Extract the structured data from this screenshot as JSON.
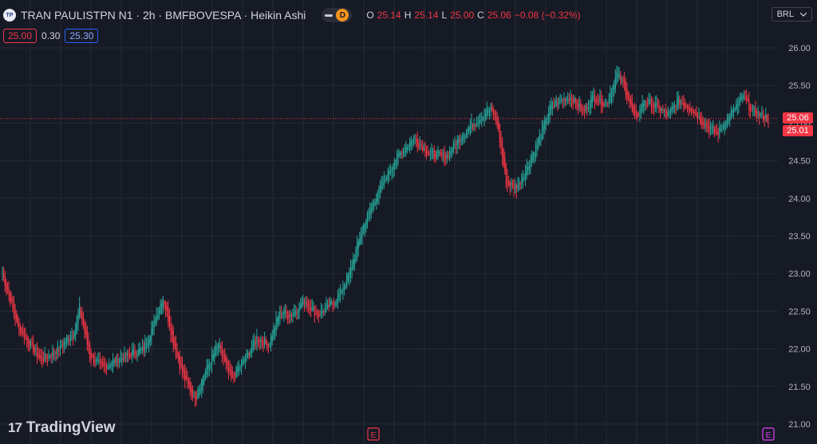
{
  "header": {
    "symbol_icon": "TP",
    "symbol_title": "TRAN PAULISTPN N1 · 2h · BMFBOVESPA · Heikin Ashi",
    "chip_d": "D",
    "ohlc": {
      "o_label": "O",
      "o": "25.14",
      "h_label": "H",
      "h": "25.14",
      "l_label": "L",
      "l": "25.00",
      "c_label": "C",
      "c": "25.06",
      "change": "−0.08 (−0.32%)"
    }
  },
  "quote": {
    "bid": "25.00",
    "spread": "0.30",
    "ask": "25.30"
  },
  "currency": {
    "label": "BRL",
    "icon": "chevron-down-icon"
  },
  "price_tags": {
    "last": "25.06",
    "prev": "25.01"
  },
  "logo": {
    "mark": "17",
    "text": "TradingView"
  },
  "event_markers": [
    "E",
    "E"
  ],
  "colors": {
    "background": "#161a25",
    "up": "#26a69a",
    "down": "#f23645",
    "grid": "#262a35",
    "earnings": "#c2185b"
  },
  "chart_data": {
    "type": "candlestick",
    "style": "Heikin Ashi",
    "interval": "2h",
    "ylim": [
      21.0,
      26.0
    ],
    "y_ticks": [
      "26.00",
      "25.50",
      "25.00",
      "24.50",
      "24.00",
      "23.50",
      "23.00",
      "22.50",
      "22.00",
      "21.50",
      "21.00"
    ],
    "last_price": 25.06,
    "grid": true,
    "anchors": [
      [
        0,
        23.0
      ],
      [
        12,
        22.3
      ],
      [
        22,
        22.05
      ],
      [
        30,
        21.85
      ],
      [
        40,
        21.95
      ],
      [
        55,
        22.2
      ],
      [
        60,
        22.55
      ],
      [
        68,
        21.9
      ],
      [
        78,
        21.75
      ],
      [
        95,
        21.9
      ],
      [
        110,
        22.0
      ],
      [
        118,
        22.35
      ],
      [
        125,
        22.7
      ],
      [
        135,
        21.95
      ],
      [
        143,
        21.55
      ],
      [
        150,
        21.35
      ],
      [
        158,
        21.7
      ],
      [
        168,
        22.05
      ],
      [
        178,
        21.6
      ],
      [
        190,
        21.9
      ],
      [
        198,
        22.15
      ],
      [
        207,
        22.05
      ],
      [
        216,
        22.5
      ],
      [
        225,
        22.45
      ],
      [
        235,
        22.65
      ],
      [
        245,
        22.45
      ],
      [
        260,
        22.65
      ],
      [
        270,
        23.0
      ],
      [
        280,
        23.6
      ],
      [
        290,
        24.0
      ],
      [
        305,
        24.5
      ],
      [
        320,
        24.8
      ],
      [
        332,
        24.6
      ],
      [
        345,
        24.55
      ],
      [
        358,
        24.85
      ],
      [
        370,
        25.05
      ],
      [
        380,
        25.2
      ],
      [
        385,
        25.0
      ],
      [
        392,
        24.2
      ],
      [
        400,
        24.15
      ],
      [
        408,
        24.4
      ],
      [
        418,
        24.8
      ],
      [
        426,
        25.2
      ],
      [
        434,
        25.3
      ],
      [
        442,
        25.35
      ],
      [
        452,
        25.15
      ],
      [
        460,
        25.35
      ],
      [
        470,
        25.25
      ],
      [
        478,
        25.65
      ],
      [
        484,
        25.5
      ],
      [
        492,
        25.05
      ],
      [
        500,
        25.3
      ],
      [
        510,
        25.2
      ],
      [
        518,
        25.1
      ],
      [
        526,
        25.3
      ],
      [
        536,
        25.2
      ],
      [
        546,
        25.0
      ],
      [
        556,
        24.85
      ],
      [
        566,
        25.1
      ],
      [
        576,
        25.35
      ],
      [
        584,
        25.15
      ],
      [
        596,
        25.06
      ]
    ]
  }
}
